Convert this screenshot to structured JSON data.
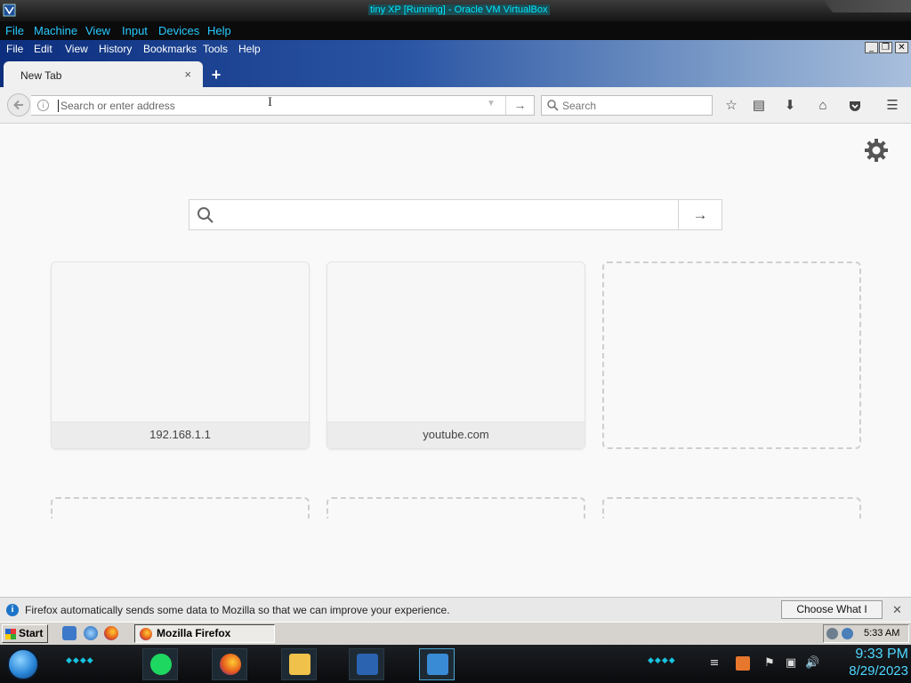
{
  "host_window": {
    "title": "tiny XP [Running] - Oracle VM VirtualBox",
    "menu": [
      "File",
      "Machine",
      "View",
      "Input",
      "Devices",
      "Help"
    ]
  },
  "firefox": {
    "menu": [
      "File",
      "Edit",
      "View",
      "History",
      "Bookmarks",
      "Tools",
      "Help"
    ],
    "window_controls": [
      "_",
      "❐",
      "✕"
    ],
    "tab": {
      "label": "New Tab",
      "close": "×"
    },
    "new_tab_button": "+",
    "urlbar": {
      "placeholder": "Search or enter address",
      "go": "→"
    },
    "searchbar": {
      "placeholder": "Search"
    },
    "toolbar_icons": [
      "star-icon",
      "reading-list-icon",
      "downloads-icon",
      "home-icon",
      "pocket-icon",
      "menu-icon"
    ]
  },
  "newtab": {
    "search_go": "→",
    "tiles": [
      {
        "label": "192.168.1.1"
      },
      {
        "label": "youtube.com"
      }
    ]
  },
  "notification": {
    "message": "Firefox automatically sends some data to Mozilla so that we can improve your experience.",
    "button": "Choose What I Share",
    "close": "✕"
  },
  "xp_taskbar": {
    "start": "Start",
    "task": "Mozilla Firefox",
    "time": "5:33 AM"
  },
  "host_taskbar": {
    "time": "9:33 PM",
    "date": "8/29/2023"
  },
  "colors": {
    "vbox_menu_text": "#27c9ff",
    "vbox_title_text": "#00e8ff",
    "firefox_titlebar": "#2b56a4",
    "clock": "#4dd7ff"
  }
}
